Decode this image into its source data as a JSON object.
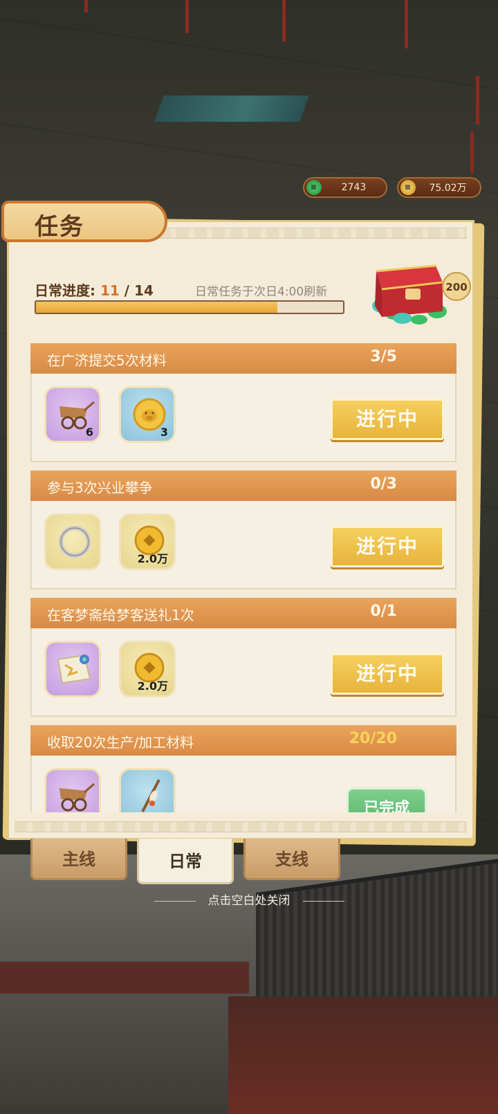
{
  "currency": {
    "jade": "2743",
    "copper": "75.02万"
  },
  "panel": {
    "title": "任务",
    "progress_label": "日常进度:",
    "progress_current": "11",
    "progress_sep": "/",
    "progress_total": "14",
    "progress_fraction": 0.7857,
    "refresh_note": "日常任务于次日4:00刷新",
    "chest_reward": "200"
  },
  "tasks": [
    {
      "title": "在广济提交5次材料",
      "count": "3/5",
      "rewards": [
        {
          "icon": "cart-icon",
          "qty": "6",
          "frame": "purple"
        },
        {
          "icon": "pig-coin-icon",
          "qty": "3",
          "frame": "blue"
        }
      ],
      "button": "进行中"
    },
    {
      "title": "参与3次兴业攀争",
      "count": "0/3",
      "rewards": [
        {
          "icon": "silver-ring-icon",
          "qty": "",
          "frame": "gold"
        },
        {
          "icon": "copper-coin-icon",
          "qty": "2.0万",
          "frame": "gold"
        }
      ],
      "button": "进行中"
    },
    {
      "title": "在客梦斋给梦客送礼1次",
      "count": "0/1",
      "rewards": [
        {
          "icon": "scroll-map-icon",
          "qty": "",
          "frame": "purple"
        },
        {
          "icon": "copper-coin-icon",
          "qty": "2.0万",
          "frame": "gold"
        }
      ],
      "button": "进行中"
    },
    {
      "title": "收取20次生产/加工材料",
      "count": "20/20",
      "rewards": [
        {
          "icon": "cart-icon",
          "qty": "",
          "frame": "purple"
        },
        {
          "icon": "brush-icon",
          "qty": "",
          "frame": "blue"
        }
      ],
      "button": "已完成"
    }
  ],
  "tabs": [
    "主线",
    "日常",
    "支线"
  ],
  "active_tab": "日常",
  "close_hint": "点击空白处关闭",
  "colors": {
    "accent": "#d98a45",
    "progress_fill": "#f0b447",
    "button_gold": "#eebc4b",
    "done_green": "#5fb872"
  }
}
